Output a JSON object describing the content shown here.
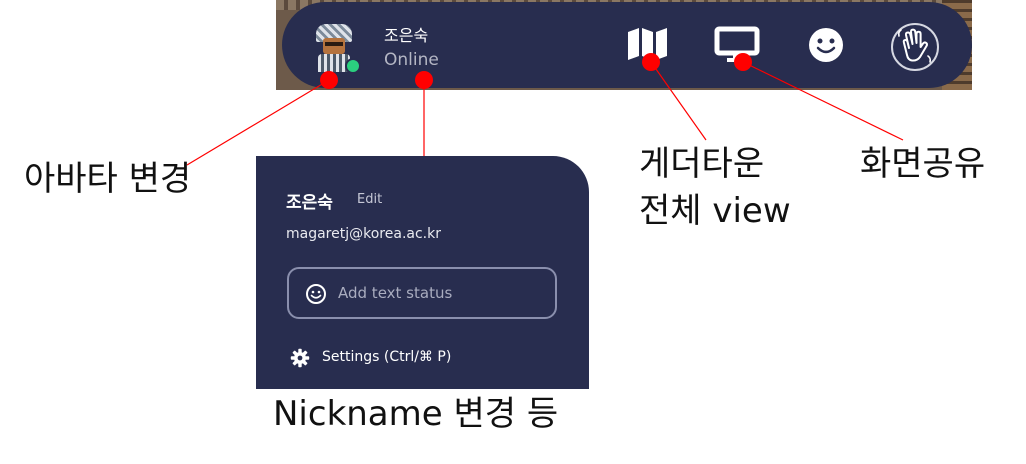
{
  "topbar": {
    "user_name": "조은숙",
    "user_status": "Online",
    "icons": [
      "map-icon",
      "screen-share-icon",
      "emoji-icon",
      "wave-icon"
    ]
  },
  "profile_panel": {
    "name": "조은숙",
    "edit_label": "Edit",
    "email": "magaretj@korea.ac.kr",
    "status_placeholder": "Add text status",
    "settings_label": "Settings (Ctrl/⌘ P)"
  },
  "annotations": {
    "avatar": "아바타 변경",
    "map_line1": "게더타운",
    "map_line2": "전체 view",
    "screen_share": "화면공유",
    "nickname": "Nickname 변경 등"
  },
  "colors": {
    "bar": "#282d4f",
    "online": "#2bd07f",
    "marker": "#ff0000"
  }
}
